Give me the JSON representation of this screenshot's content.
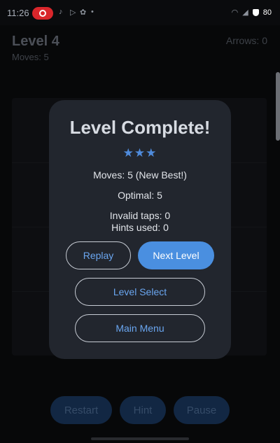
{
  "status_bar": {
    "time": "11:26",
    "battery": "80"
  },
  "hud": {
    "level": "Level 4",
    "moves": "Moves: 5",
    "arrows": "Arrows: 0"
  },
  "bottom_bar": {
    "restart": "Restart",
    "hint": "Hint",
    "pause": "Pause"
  },
  "dialog": {
    "title": "Level Complete!",
    "stars": "★★★",
    "moves_line": "Moves: 5 (New Best!)",
    "optimal_line": "Optimal: 5",
    "invalid_taps_line": "Invalid taps: 0",
    "hints_used_line": "Hints used: 0",
    "replay": "Replay",
    "next_level": "Next Level",
    "level_select": "Level Select",
    "main_menu": "Main Menu"
  },
  "colors": {
    "accent": "#4a8fe0",
    "dialog_bg": "#22262e",
    "record": "#d9262b"
  }
}
